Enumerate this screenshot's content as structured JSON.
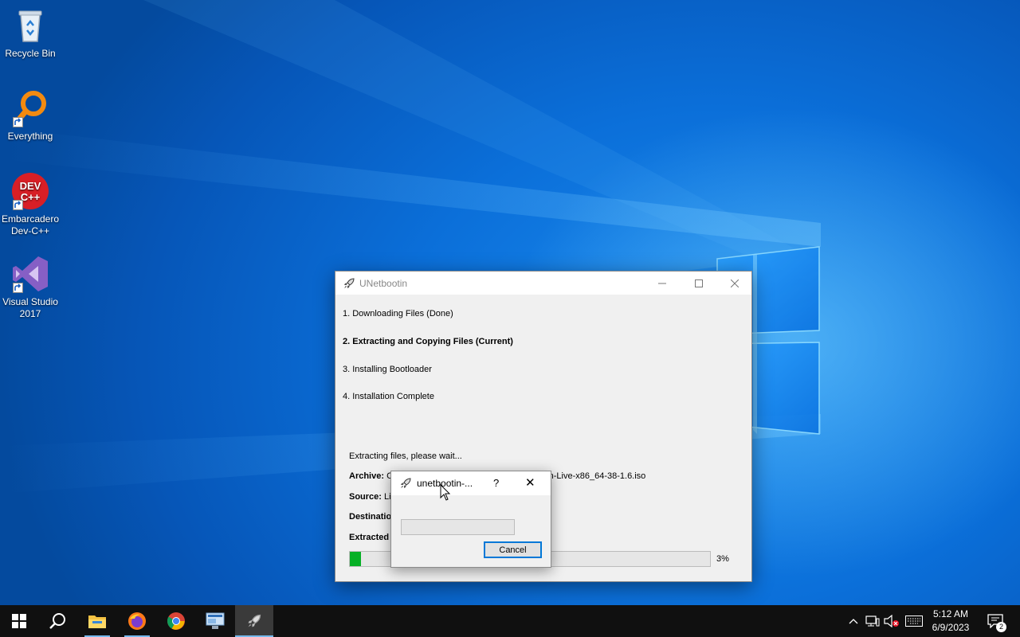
{
  "desktop": {
    "icons": [
      {
        "label": "Recycle Bin",
        "icon": "recycle-bin-icon"
      },
      {
        "label": "Everything",
        "icon": "everything-search-icon"
      },
      {
        "label": "Embarcadero Dev-C++",
        "icon": "devcpp-icon",
        "glyph_text": "DEV C++"
      },
      {
        "label": "Visual Studio 2017",
        "icon": "visual-studio-icon"
      }
    ]
  },
  "window": {
    "title": "UNetbootin",
    "steps": [
      "1. Downloading Files (Done)",
      "2. Extracting and Copying Files (Current)",
      "3. Installing Bootloader",
      "4. Installation Complete"
    ],
    "status": "Extracting files, please wait...",
    "archive_label": "Archive:",
    "archive_value": "C",
    "archive_value_tail": "tion-Live-x86_64-38-1.6.iso",
    "source_label": "Source:",
    "source_value": "Li",
    "destination_label": "Destinatio",
    "extracted_label": "Extracted",
    "progress_percent": 3,
    "progress_text": "3%"
  },
  "dialog": {
    "title": "unetbootin-...",
    "help_label": "?",
    "close_label": "✕",
    "cancel_label": "Cancel",
    "progress_percent": 0
  },
  "taskbar": {
    "items": [
      "start-icon",
      "search-icon",
      "file-explorer-icon",
      "firefox-icon",
      "chrome-icon",
      "remote-desktop-icon",
      "unetbootin-icon"
    ],
    "active_item": "unetbootin-icon",
    "clock_time": "5:12 AM",
    "clock_date": "6/9/2023",
    "notification_count": "2"
  },
  "colors": {
    "progress_green": "#06b025",
    "focus_blue": "#0078d7",
    "taskbar": "#101010"
  }
}
